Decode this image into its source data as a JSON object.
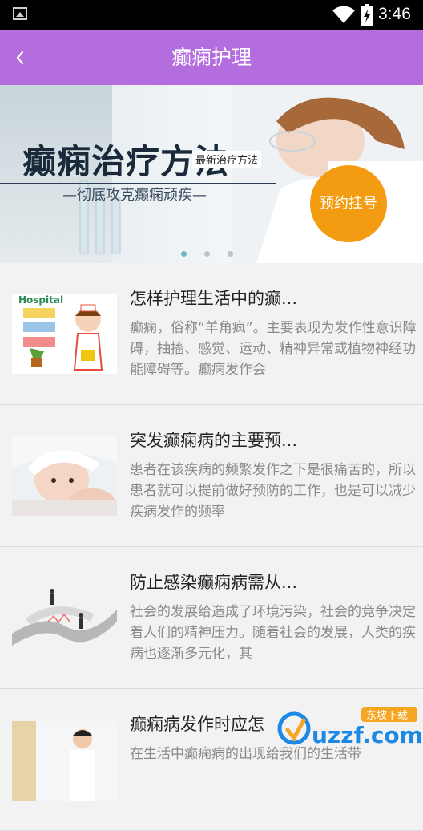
{
  "status_bar": {
    "time": "3:46"
  },
  "app_bar": {
    "title": "癫痫护理"
  },
  "banner": {
    "headline": "癫痫治疗方法",
    "tag": "最新治疗方法",
    "subtitle": "—彻底攻克癫痫顽疾—",
    "badge": "预约挂号",
    "slides": 3,
    "active_slide": 0
  },
  "articles": [
    {
      "title": "怎样护理生活中的癫...",
      "summary": "癫痫，俗称“羊角疯”。主要表现为发作性意识障碍，抽搐、感觉、运动、精神异常或植物神经功能障碍等。癫痫发作会"
    },
    {
      "title": "突发癫痫病的主要预...",
      "summary": "患者在该疾病的频繁发作之下是很痛苦的，所以患者就可以提前做好预防的工作，也是可以减少疾病发作的频率"
    },
    {
      "title": "防止感染癫痫病需从...",
      "summary": "社会的发展给造成了环境污染，社会的竞争决定着人们的精神压力。随着社会的发展，人类的疾病也逐渐多元化，其"
    },
    {
      "title": "癫痫病发作时应怎",
      "summary": "在生活中癫痫病的出现给我们的生活带"
    }
  ],
  "thumbnail_labels": {
    "hospital": "Hospital"
  },
  "watermark": {
    "logo_text": "uzzf.com",
    "tagline": "东坡下载"
  }
}
